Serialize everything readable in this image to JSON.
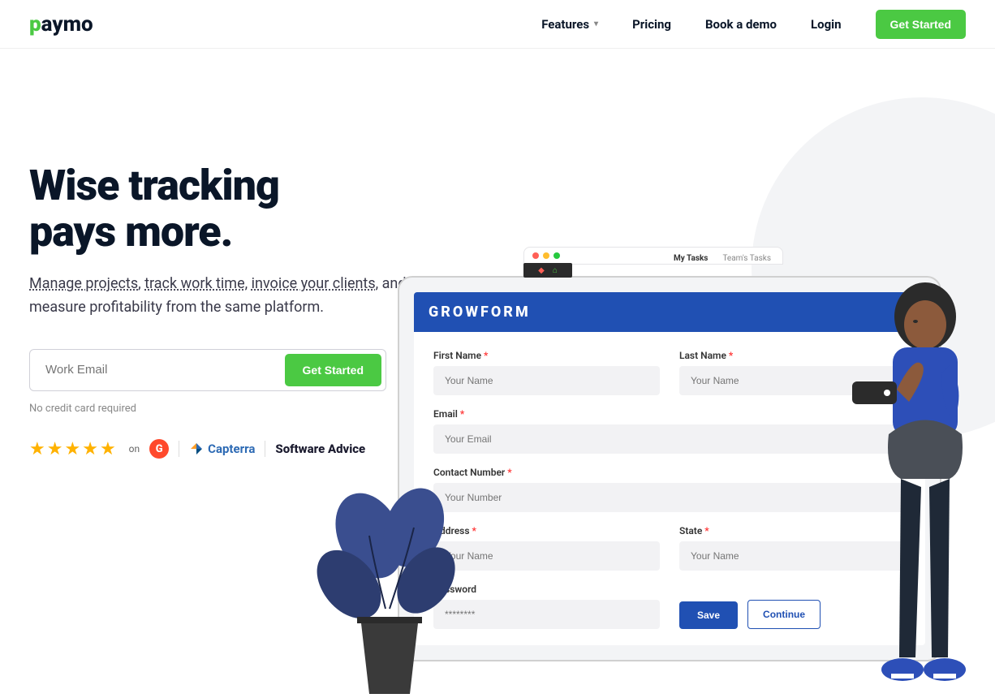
{
  "header": {
    "logo": "paymo",
    "nav": {
      "features": "Features",
      "pricing": "Pricing",
      "demo": "Book a demo",
      "login": "Login",
      "cta": "Get Started"
    }
  },
  "hero": {
    "title_line1": "Wise tracking",
    "title_line2": "pays more.",
    "sub_link1": "Manage projects",
    "sub_sep1": ", ",
    "sub_link2": "track work time",
    "sub_sep2": ", ",
    "sub_link3": "invoice your clients",
    "sub_rest": ", and measure profitability from the same platform.",
    "email_placeholder": "Work Email",
    "email_cta": "Get Started",
    "no_cc": "No credit card required",
    "on": "on",
    "g2": "G",
    "capterra": "Capterra",
    "software_advice": "Software Advice"
  },
  "mockup": {
    "tabs": {
      "my_tasks": "My Tasks",
      "team_tasks": "Team's Tasks"
    }
  },
  "form": {
    "header": "GROWFORM",
    "first_name": {
      "label": "First Name",
      "placeholder": "Your Name"
    },
    "last_name": {
      "label": "Last Name",
      "placeholder": "Your Name"
    },
    "email": {
      "label": "Email",
      "placeholder": "Your Email"
    },
    "contact": {
      "label": "Contact Number",
      "placeholder": "Your Number"
    },
    "address": {
      "label": "Address",
      "placeholder": "Your Name"
    },
    "state": {
      "label": "State",
      "placeholder": "Your Name"
    },
    "password": {
      "label": "Password",
      "placeholder": "********"
    },
    "save": "Save",
    "continue": "Continue"
  }
}
